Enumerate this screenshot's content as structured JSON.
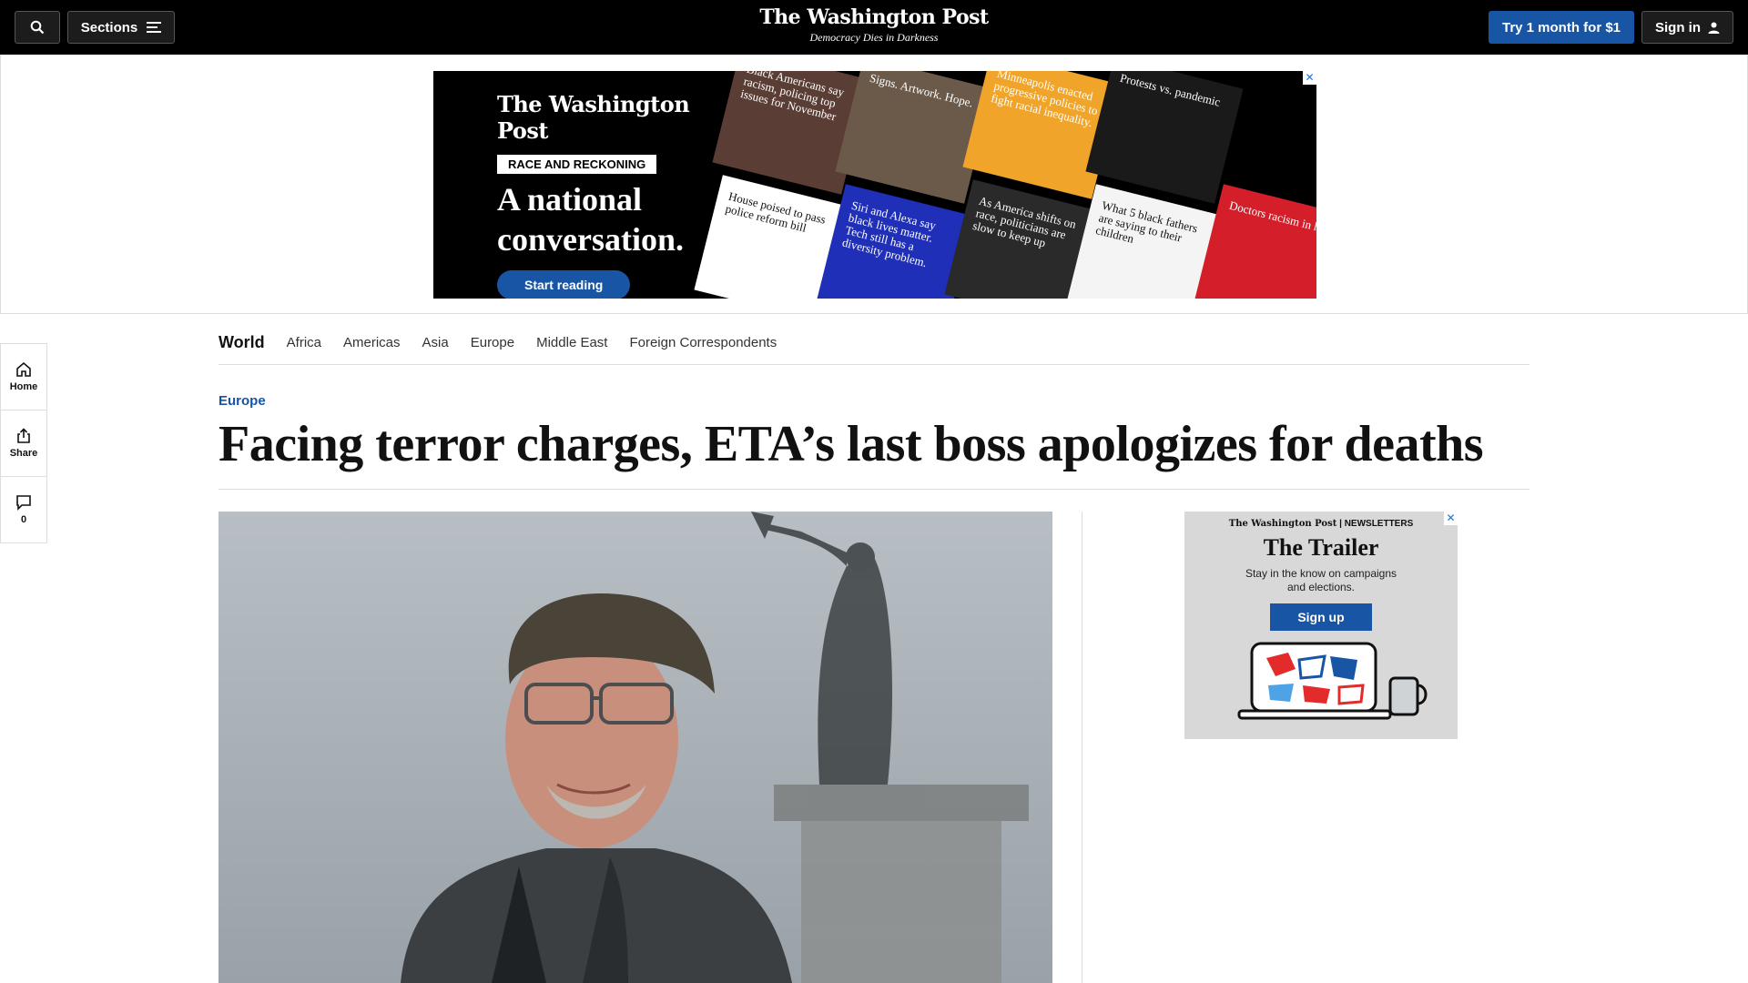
{
  "header": {
    "sections_label": "Sections",
    "logo": "The Washington Post",
    "tagline": "Democracy Dies in Darkness",
    "subscribe_label": "Try 1 month for $1",
    "signin_label": "Sign in"
  },
  "ad_banner": {
    "close_label": "✕",
    "logo": "The Washington Post",
    "pill": "RACE AND RECKONING",
    "headline": "A national conversation.",
    "cta": "Start reading",
    "tiles": [
      {
        "text": "Black Americans say racism, policing top issues for November",
        "bg": "#5a3d35",
        "color": "#ffffff"
      },
      {
        "text": "House poised to pass police reform bill",
        "bg": "#ffffff",
        "color": "#111111"
      },
      {
        "text": "Signs. Artwork. Hope.",
        "bg": "#6b5a4a",
        "color": "#ffffff"
      },
      {
        "text": "Siri and Alexa say black lives matter. Tech still has a diversity problem.",
        "bg": "#1f2fb8",
        "color": "#ffffff"
      },
      {
        "text": "Minneapolis enacted progressive policies to fight racial inequality.",
        "bg": "#f0a52a",
        "color": "#ffffff"
      },
      {
        "text": "As America shifts on race, politicians are slow to keep up",
        "bg": "#2a2a2a",
        "color": "#ffffff"
      },
      {
        "text": "Protests vs. pandemic",
        "bg": "#1a1a1a",
        "color": "#ffffff"
      },
      {
        "text": "What 5 black fathers are saying to their children",
        "bg": "#f4f4f4",
        "color": "#111111"
      },
      {
        "text": "Doctors racism in h",
        "bg": "#d41e2a",
        "color": "#ffffff"
      }
    ]
  },
  "rail": {
    "home_label": "Home",
    "share_label": "Share",
    "comments_count": "0"
  },
  "subnav": {
    "section_title": "World",
    "links": [
      "Africa",
      "Americas",
      "Asia",
      "Europe",
      "Middle East",
      "Foreign Correspondents"
    ]
  },
  "article": {
    "kicker": "Europe",
    "headline": "Facing terror charges, ETA’s last boss apologizes for deaths"
  },
  "newsletter_ad": {
    "close_label": "✕",
    "brand": "The Washington Post",
    "brand_suffix": "NEWSLETTERS",
    "title": "The Trailer",
    "description": "Stay in the know on campaigns and elections.",
    "cta": "Sign up"
  }
}
